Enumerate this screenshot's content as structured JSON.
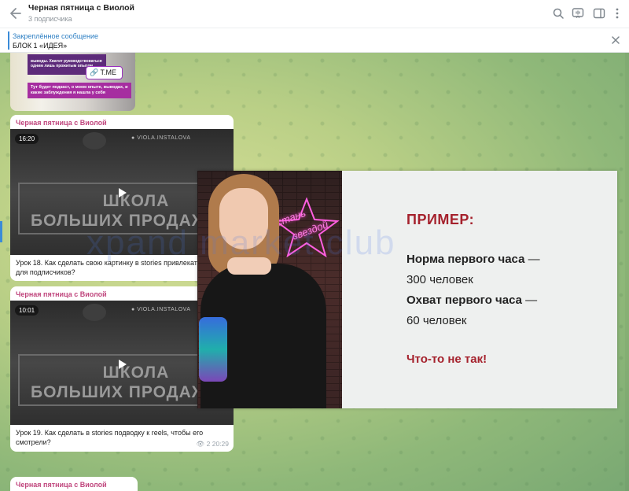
{
  "header": {
    "title": "Черная пятница с Виолой",
    "subtitle": "3 подписчика"
  },
  "pinned": {
    "label": "Закреплённое сообщение",
    "text": "БЛОК 1 «ИДЕЯ»"
  },
  "top_image": {
    "strip1": "выводы. Хватит руководствоваться одним лишь прожитым опытом",
    "tme_label": "T.ME",
    "strip2": "Тут будет подкаст, о моем опыте, выводах, и какие заблуждения я нашла у себя"
  },
  "messages": [
    {
      "sender": "Черная пятница с Виолой",
      "duration": "16:20",
      "handle": "VIOLA.INSTALOVA",
      "video_line1": "ШКОЛА",
      "video_line2": "БОЛЬШИХ ПРОДАЖ",
      "caption": "Урок 18. Как сделать свою картинку в stories привлекательной для подписчиков?"
    },
    {
      "sender": "Черная пятница с Виолой",
      "duration": "10:01",
      "handle": "VIOLA.INSTALOVA",
      "video_line1": "ШКОЛА",
      "video_line2": "БОЛЬШИХ ПРОДАЖ",
      "caption": "Урок 19. Как сделать в stories подводку к reels, чтобы его смотрели?",
      "views": "2",
      "time": "20:29"
    },
    {
      "sender": "Черная пятница с Виолой"
    }
  ],
  "slide": {
    "neon_line1": "стань",
    "neon_line2": "звездой",
    "title": "ПРИМЕР:",
    "line1_bold": "Норма первого часа",
    "line1_dash": "—",
    "line2": "300 человек",
    "line3_bold": "Охват первого часа",
    "line3_dash": "—",
    "line4": "60 человек",
    "conclusion": "Что-то не так!"
  },
  "watermark": "xpand market club",
  "colors": {
    "accent": "#3a8bd8",
    "sender": "#c0467d",
    "slide_red": "#a5222d"
  }
}
